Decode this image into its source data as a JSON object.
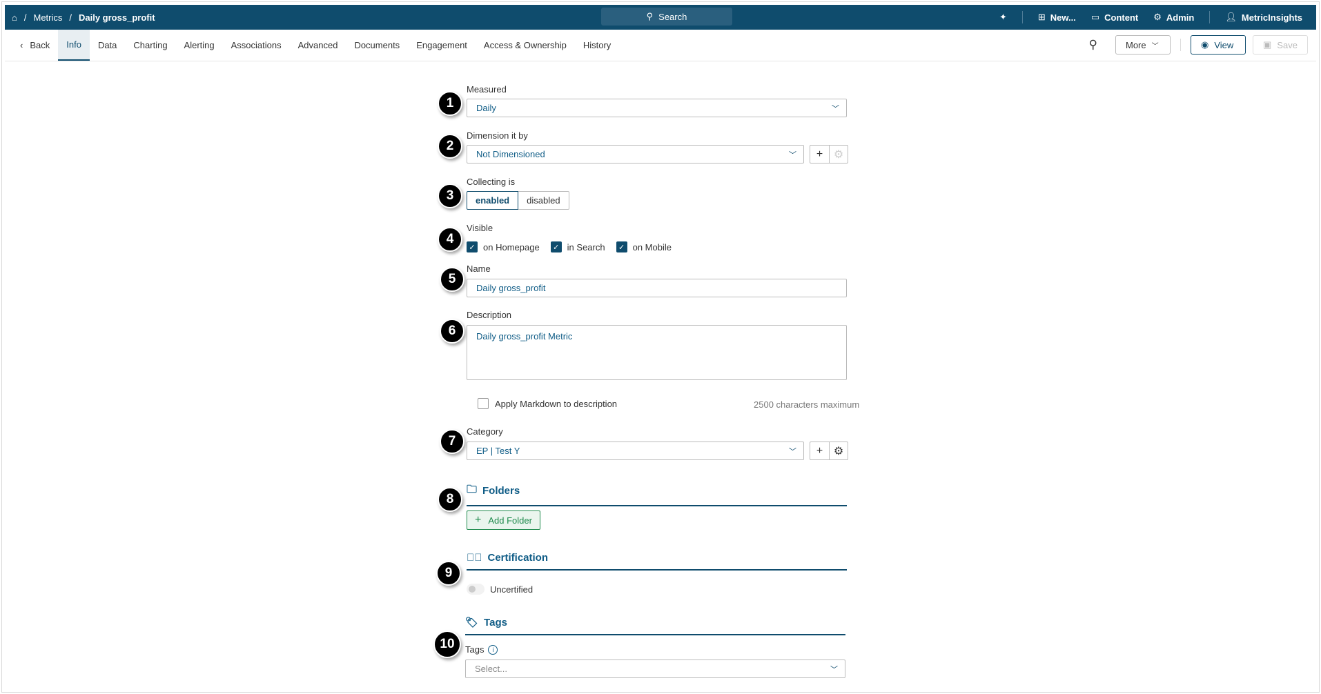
{
  "header": {
    "breadcrumb": [
      "Metrics",
      "Daily gross_profit"
    ],
    "search": "Search",
    "nav": {
      "new": "New...",
      "content": "Content",
      "admin": "Admin",
      "user": "MetricInsights"
    }
  },
  "tabs": {
    "back": "Back",
    "items": [
      "Info",
      "Data",
      "Charting",
      "Alerting",
      "Associations",
      "Advanced",
      "Documents",
      "Engagement",
      "Access & Ownership",
      "History"
    ],
    "more": "More",
    "view": "View",
    "save": "Save"
  },
  "form": {
    "measured": {
      "label": "Measured",
      "value": "Daily"
    },
    "dimension": {
      "label": "Dimension it by",
      "value": "Not Dimensioned"
    },
    "collecting": {
      "label": "Collecting is",
      "enabled": "enabled",
      "disabled": "disabled",
      "selected": "enabled"
    },
    "visible": {
      "label": "Visible",
      "homepage": "on Homepage",
      "search": "in Search",
      "mobile": "on Mobile"
    },
    "name": {
      "label": "Name",
      "value": "Daily gross_profit"
    },
    "description": {
      "label": "Description",
      "value": "Daily gross_profit Metric",
      "markdown": "Apply Markdown to description",
      "max": "2500 characters maximum"
    },
    "category": {
      "label": "Category",
      "value": "EP | Test Y"
    },
    "folders": {
      "title": "Folders",
      "add": "Add Folder"
    },
    "certification": {
      "title": "Certification",
      "status": "Uncertified"
    },
    "tags": {
      "title": "Tags",
      "label": "Tags",
      "placeholder": "Select..."
    }
  },
  "steps": [
    "1",
    "2",
    "3",
    "4",
    "5",
    "6",
    "7",
    "8",
    "9",
    "10"
  ],
  "colors": {
    "brand": "#0f4c6d",
    "accent": "#0f5c86",
    "success": "#1e8a4c"
  }
}
